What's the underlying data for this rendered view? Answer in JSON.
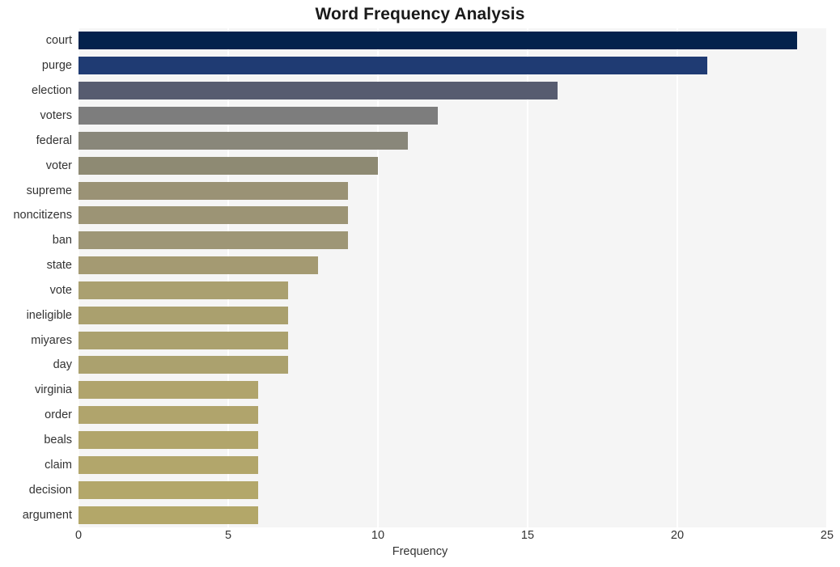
{
  "figure": {
    "background_color": "#ffffff",
    "plot_background_color": "#f5f5f5",
    "gridline_color": "#ffffff"
  },
  "chart_data": {
    "type": "bar",
    "orientation": "horizontal",
    "title": "Word Frequency Analysis",
    "xlabel": "Frequency",
    "ylabel": "",
    "xlim": [
      0,
      25
    ],
    "ylim": [
      0,
      20
    ],
    "xticks": [
      0,
      5,
      10,
      15,
      20,
      25
    ],
    "xtick_labels": [
      "0",
      "5",
      "10",
      "15",
      "20",
      "25"
    ],
    "grid": "vertical-only",
    "legend": "none",
    "categories": [
      "court",
      "purge",
      "election",
      "voters",
      "federal",
      "voter",
      "supreme",
      "noncitizens",
      "ban",
      "state",
      "vote",
      "ineligible",
      "miyares",
      "day",
      "virginia",
      "order",
      "beals",
      "claim",
      "decision",
      "argument"
    ],
    "values": [
      24,
      21,
      16,
      12,
      11,
      10,
      9,
      9,
      9,
      8,
      7,
      7,
      7,
      7,
      6,
      6,
      6,
      6,
      6,
      6
    ],
    "bar_colors": [
      "#03224c",
      "#1f3b73",
      "#575c70",
      "#7d7d7d",
      "#89877a",
      "#8e8a73",
      "#9a9275",
      "#9c9475",
      "#9e9676",
      "#a49a72",
      "#aaa070",
      "#aaa06e",
      "#aba16e",
      "#aba16e",
      "#b0a46c",
      "#b0a46c",
      "#b1a56b",
      "#b2a66b",
      "#b3a76a",
      "#b3a769"
    ],
    "series": [
      {
        "name": "Frequency",
        "points": [
          {
            "label": "court",
            "value": 24
          },
          {
            "label": "purge",
            "value": 21
          },
          {
            "label": "election",
            "value": 16
          },
          {
            "label": "voters",
            "value": 12
          },
          {
            "label": "federal",
            "value": 11
          },
          {
            "label": "voter",
            "value": 10
          },
          {
            "label": "supreme",
            "value": 9
          },
          {
            "label": "noncitizens",
            "value": 9
          },
          {
            "label": "ban",
            "value": 9
          },
          {
            "label": "state",
            "value": 8
          },
          {
            "label": "vote",
            "value": 7
          },
          {
            "label": "ineligible",
            "value": 7
          },
          {
            "label": "miyares",
            "value": 7
          },
          {
            "label": "day",
            "value": 7
          },
          {
            "label": "virginia",
            "value": 6
          },
          {
            "label": "order",
            "value": 6
          },
          {
            "label": "beals",
            "value": 6
          },
          {
            "label": "claim",
            "value": 6
          },
          {
            "label": "decision",
            "value": 6
          },
          {
            "label": "argument",
            "value": 6
          }
        ]
      }
    ]
  }
}
